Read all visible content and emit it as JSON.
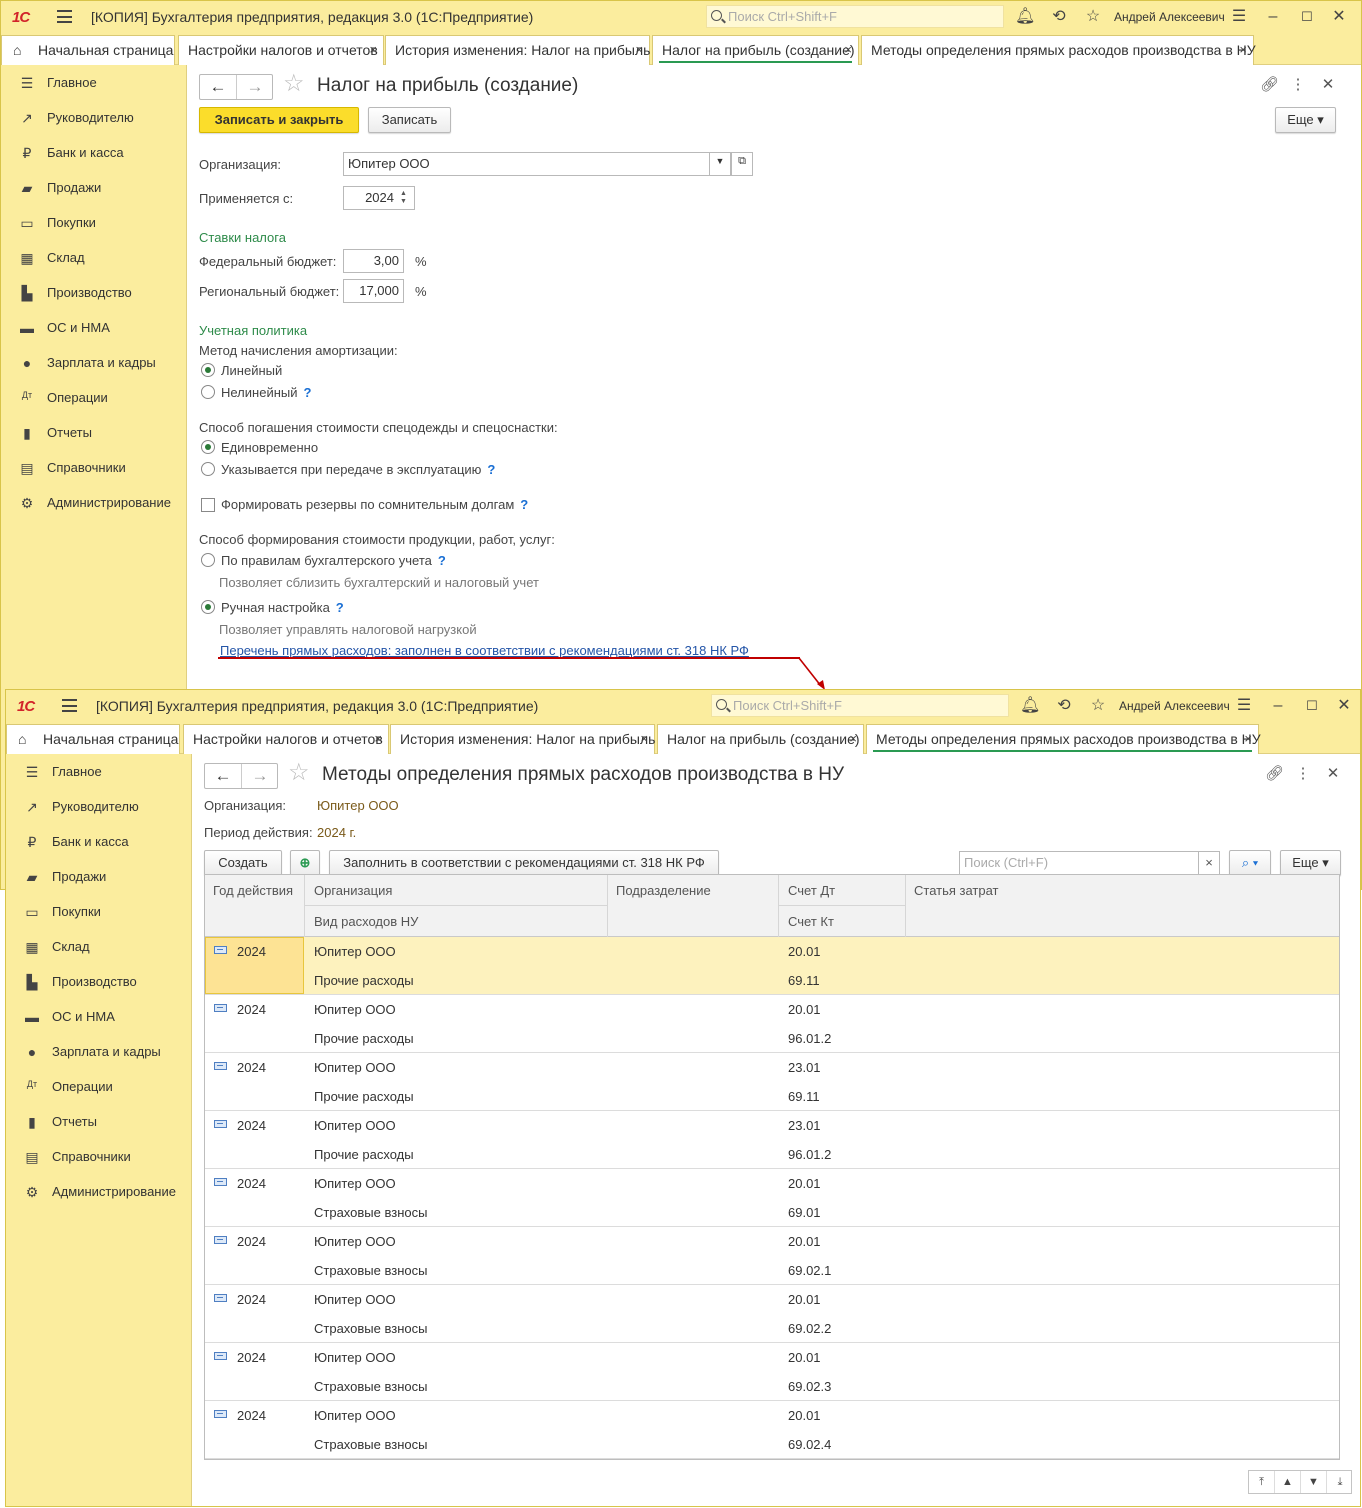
{
  "app": {
    "logo": "1С",
    "title": "[КОПИЯ] Бухгалтерия предприятия, редакция 3.0  (1С:Предприятие)",
    "search_placeholder": "Поиск Ctrl+Shift+F",
    "user": "Андрей Алексеевич"
  },
  "tabs": {
    "home": "Начальная страница",
    "items": [
      {
        "label": "Настройки налогов и отчетов"
      },
      {
        "label": "История изменения: Налог на прибыль"
      },
      {
        "label": "Налог на прибыль (создание)"
      },
      {
        "label": "Методы определения прямых расходов производства в НУ"
      }
    ],
    "close": "×"
  },
  "sidebar": {
    "items": [
      {
        "label": "Главное",
        "icon": "menu-icon"
      },
      {
        "label": "Руководителю",
        "icon": "trend-icon"
      },
      {
        "label": "Банк и касса",
        "icon": "ruble-icon"
      },
      {
        "label": "Продажи",
        "icon": "bag-icon"
      },
      {
        "label": "Покупки",
        "icon": "cart-icon"
      },
      {
        "label": "Склад",
        "icon": "grid-icon"
      },
      {
        "label": "Производство",
        "icon": "factory-icon"
      },
      {
        "label": "ОС и НМА",
        "icon": "truck-icon"
      },
      {
        "label": "Зарплата и кадры",
        "icon": "people-icon"
      },
      {
        "label": "Операции",
        "icon": "dtkt-icon"
      },
      {
        "label": "Отчеты",
        "icon": "chart-icon"
      },
      {
        "label": "Справочники",
        "icon": "book-icon"
      },
      {
        "label": "Администрирование",
        "icon": "gear-icon"
      }
    ]
  },
  "form1": {
    "title": "Налог на прибыль (создание)",
    "save_close": "Записать и закрыть",
    "save": "Записать",
    "more": "Еще",
    "org_label": "Организация:",
    "org_value": "Юпитер ООО",
    "applies_label": "Применяется с:",
    "applies_value": "2024",
    "rates_section": "Ставки налога",
    "federal_label": "Федеральный бюджет:",
    "federal_value": "3,00",
    "regional_label": "Региональный бюджет:",
    "regional_value": "17,000",
    "percent": "%",
    "policy_section": "Учетная политика",
    "amort_label": "Метод начисления амортизации:",
    "amort_linear": "Линейный",
    "amort_nonlinear": "Нелинейный",
    "workwear_label": "Способ погашения стоимости спецодежды и спецоснастки:",
    "workwear_once": "Единовременно",
    "workwear_transfer": "Указывается при передаче в эксплуатацию",
    "reserves_label": "Формировать резервы по сомнительным долгам",
    "cost_label": "Способ формирования стоимости продукции, работ, услуг:",
    "cost_rules": "По правилам бухгалтерского учета",
    "cost_rules_hint": "Позволяет сблизить бухгалтерский и налоговый учет",
    "cost_manual": "Ручная настройка",
    "cost_manual_hint": "Позволяет управлять налоговой нагрузкой",
    "direct_link": "Перечень прямых расходов: заполнен в соответствии с рекомендациями ст. 318 НК РФ",
    "help": "?"
  },
  "form2": {
    "title": "Методы определения прямых расходов производства в НУ",
    "org_label": "Организация:",
    "org_value": "Юпитер ООО",
    "period_label": "Период действия:",
    "period_value": "2024 г.",
    "create": "Создать",
    "fill": "Заполнить в соответствии с рекомендациями ст. 318 НК РФ",
    "search_placeholder": "Поиск (Ctrl+F)",
    "more": "Еще",
    "columns": {
      "year": "Год действия",
      "org": "Организация",
      "expense_type": "Вид расходов НУ",
      "division": "Подразделение",
      "debit": "Счет Дт",
      "credit": "Счет Кт",
      "cost_item": "Статья затрат"
    },
    "rows": [
      {
        "year": "2024",
        "org": "Юпитер ООО",
        "expense": "Прочие расходы",
        "debit": "20.01",
        "credit": "69.11"
      },
      {
        "year": "2024",
        "org": "Юпитер ООО",
        "expense": "Прочие расходы",
        "debit": "20.01",
        "credit": "96.01.2"
      },
      {
        "year": "2024",
        "org": "Юпитер ООО",
        "expense": "Прочие расходы",
        "debit": "23.01",
        "credit": "69.11"
      },
      {
        "year": "2024",
        "org": "Юпитер ООО",
        "expense": "Прочие расходы",
        "debit": "23.01",
        "credit": "96.01.2"
      },
      {
        "year": "2024",
        "org": "Юпитер ООО",
        "expense": "Страховые взносы",
        "debit": "20.01",
        "credit": "69.01"
      },
      {
        "year": "2024",
        "org": "Юпитер ООО",
        "expense": "Страховые взносы",
        "debit": "20.01",
        "credit": "69.02.1"
      },
      {
        "year": "2024",
        "org": "Юпитер ООО",
        "expense": "Страховые взносы",
        "debit": "20.01",
        "credit": "69.02.2"
      },
      {
        "year": "2024",
        "org": "Юпитер ООО",
        "expense": "Страховые взносы",
        "debit": "20.01",
        "credit": "69.02.3"
      },
      {
        "year": "2024",
        "org": "Юпитер ООО",
        "expense": "Страховые взносы",
        "debit": "20.01",
        "credit": "69.02.4"
      }
    ]
  },
  "colors": {
    "accent_yellow": "#fbed9e",
    "primary_button": "#fbdd2b",
    "section_green": "#2e8b4a",
    "link_blue": "#2455a8",
    "annotation_red": "#c00000"
  }
}
